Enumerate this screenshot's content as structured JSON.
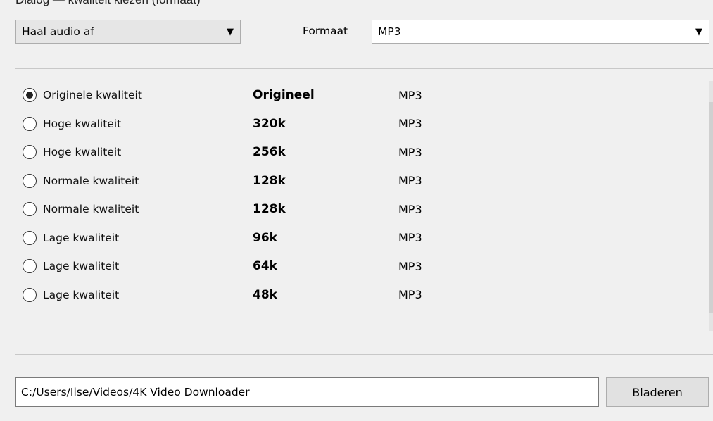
{
  "header_partial_text": "Dialog — kwaliteit kiezen (formaat)",
  "mode_select": {
    "value": "Haal audio af"
  },
  "format": {
    "label": "Formaat",
    "value": "MP3"
  },
  "options": [
    {
      "label": "Originele kwaliteit",
      "bitrate": "Origineel",
      "format": "MP3",
      "selected": true
    },
    {
      "label": "Hoge kwaliteit",
      "bitrate": "320k",
      "format": "MP3",
      "selected": false
    },
    {
      "label": "Hoge kwaliteit",
      "bitrate": "256k",
      "format": "MP3",
      "selected": false
    },
    {
      "label": "Normale kwaliteit",
      "bitrate": "128k",
      "format": "MP3",
      "selected": false
    },
    {
      "label": "Normale kwaliteit",
      "bitrate": "128k",
      "format": "MP3",
      "selected": false
    },
    {
      "label": "Lage kwaliteit",
      "bitrate": "96k",
      "format": "MP3",
      "selected": false
    },
    {
      "label": "Lage kwaliteit",
      "bitrate": "64k",
      "format": "MP3",
      "selected": false
    },
    {
      "label": "Lage kwaliteit",
      "bitrate": "48k",
      "format": "MP3",
      "selected": false
    }
  ],
  "save_path": {
    "value": "C:/Users/Ilse/Videos/4K Video Downloader"
  },
  "browse_button": {
    "label": "Bladeren"
  }
}
